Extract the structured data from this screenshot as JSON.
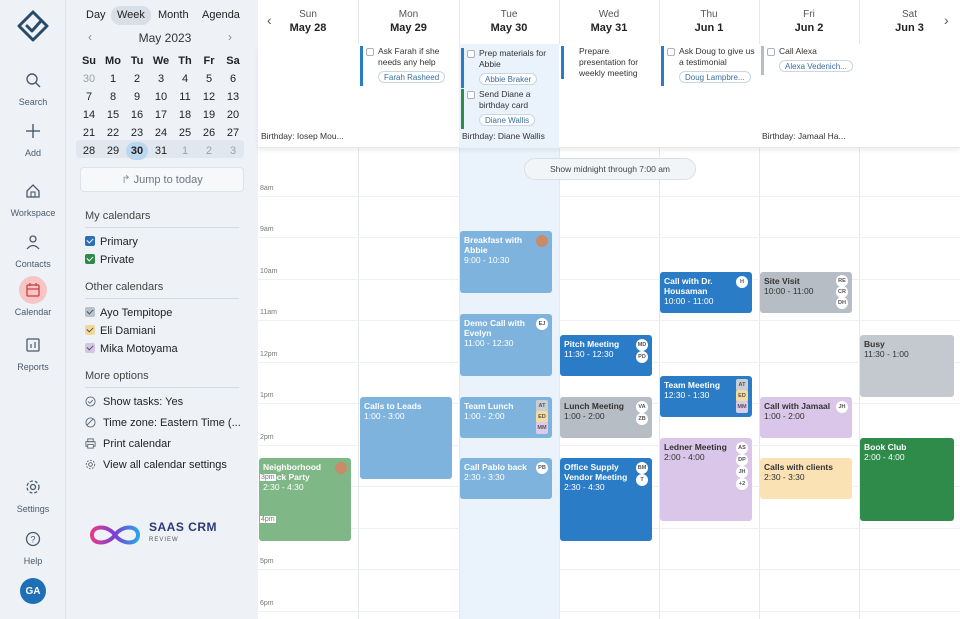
{
  "rail": {
    "items": [
      {
        "label": "Search",
        "icon": "search-icon"
      },
      {
        "label": "Add",
        "icon": "plus-icon"
      },
      {
        "label": "Workspace",
        "icon": "home-icon"
      },
      {
        "label": "Contacts",
        "icon": "person-icon"
      },
      {
        "label": "Calendar",
        "icon": "calendar-icon",
        "active": true
      },
      {
        "label": "Reports",
        "icon": "reports-icon"
      },
      {
        "label": "Settings",
        "icon": "gear-icon"
      },
      {
        "label": "Help",
        "icon": "help-icon"
      }
    ],
    "avatar": "GA"
  },
  "sidebar": {
    "view_tabs": [
      "Day",
      "Week",
      "Month",
      "Agenda"
    ],
    "selected_view": "Week",
    "mini_month": "May 2023",
    "weekdays": [
      "Su",
      "Mo",
      "Tu",
      "We",
      "Th",
      "Fr",
      "Sa"
    ],
    "weeks": [
      [
        "30",
        "1",
        "2",
        "3",
        "4",
        "5",
        "6"
      ],
      [
        "7",
        "8",
        "9",
        "10",
        "11",
        "12",
        "13"
      ],
      [
        "14",
        "15",
        "16",
        "17",
        "18",
        "19",
        "20"
      ],
      [
        "21",
        "22",
        "23",
        "24",
        "25",
        "26",
        "27"
      ],
      [
        "28",
        "29",
        "30",
        "31",
        "1",
        "2",
        "3"
      ]
    ],
    "jump_label": "Jump to today",
    "my_calendars_title": "My calendars",
    "my_calendars": [
      {
        "name": "Primary",
        "color": "#2a6fb8"
      },
      {
        "name": "Private",
        "color": "#2e8b4a"
      }
    ],
    "other_calendars_title": "Other calendars",
    "other_calendars": [
      {
        "name": "Ayo Tempitope",
        "color": "#b9c1ca"
      },
      {
        "name": "Eli Damiani",
        "color": "#f2d79a"
      },
      {
        "name": "Mika Motoyama",
        "color": "#d4c4e6"
      }
    ],
    "more_options_title": "More options",
    "more_options": [
      {
        "label": "Show tasks: Yes",
        "icon": "check-circle-icon"
      },
      {
        "label": "Time zone: Eastern Time (...",
        "icon": "globe-icon"
      },
      {
        "label": "Print calendar",
        "icon": "print-icon"
      },
      {
        "label": "View all calendar settings",
        "icon": "gear-icon"
      }
    ],
    "brand_name": "SAAS CRM",
    "brand_sub": "REVIEW"
  },
  "days": [
    {
      "name": "Sun",
      "date": "May 28"
    },
    {
      "name": "Mon",
      "date": "May 29"
    },
    {
      "name": "Tue",
      "date": "May 30"
    },
    {
      "name": "Wed",
      "date": "May 31"
    },
    {
      "name": "Thu",
      "date": "Jun 1"
    },
    {
      "name": "Fri",
      "date": "Jun 2"
    },
    {
      "name": "Sat",
      "date": "Jun 3"
    }
  ],
  "tasks": {
    "mon": {
      "text": "Ask Farah if she needs any help",
      "pill": "Farah Rasheed"
    },
    "tue1": {
      "text": "Prep materials for Abbie",
      "pill": "Abbie Braker"
    },
    "tue2": {
      "text": "Send Diane a birthday card",
      "pill": "Diane Wallis"
    },
    "wed": {
      "text": "Prepare presentation for weekly meeting"
    },
    "thu": {
      "text": "Ask Doug to give us a testimonial",
      "pill": "Doug Lampbre..."
    },
    "fri": {
      "text": "Call Alexa",
      "pill": "Alexa Vedenich..."
    }
  },
  "birthdays": {
    "sun": "Birthday: Iosep Mou...",
    "tue": "Birthday: Diane Wallis",
    "fri": "Birthday: Jamaal Ha..."
  },
  "show_midnight": "Show midnight through 7:00 am",
  "hours": [
    "8am",
    "9am",
    "10am",
    "11am",
    "12pm",
    "1pm",
    "2pm",
    "3pm",
    "4pm",
    "5pm",
    "6pm"
  ],
  "events": {
    "breakfast": {
      "title": "Breakfast with Abbie",
      "time": "9:00 - 10:30"
    },
    "demo": {
      "title": "Demo Call with Evelyn",
      "time": "11:00 - 12:30",
      "badges": [
        "EJ"
      ]
    },
    "team_lunch": {
      "title": "Team Lunch",
      "time": "1:00 - 2:00",
      "badges": [
        "AT",
        "ED",
        "MM"
      ]
    },
    "call_pablo": {
      "title": "Call Pablo back",
      "time": "2:30 - 3:30",
      "badges": [
        "PB"
      ]
    },
    "calls_leads": {
      "title": "Calls to Leads",
      "time": "1:00 - 3:00"
    },
    "neighborhood": {
      "title": "Neighborhood Block Party",
      "time": "2:30 - 4:30",
      "inner_labels": [
        "3pm",
        "4pm"
      ]
    },
    "pitch": {
      "title": "Pitch Meeting",
      "time": "11:30 - 12:30",
      "badges": [
        "MD",
        "PD"
      ]
    },
    "lunch_meeting": {
      "title": "Lunch Meeting",
      "time": "1:00 - 2:00",
      "badges": [
        "VA",
        "ZB"
      ]
    },
    "office_supply": {
      "title": "Office Supply Vendor Meeting",
      "time": "2:30 - 4:30",
      "badges": [
        "BM",
        "T"
      ]
    },
    "call_dr": {
      "title": "Call with Dr. Housaman",
      "time": "10:00 - 11:00",
      "badges": [
        "H"
      ]
    },
    "team_meeting": {
      "title": "Team Meeting",
      "time": "12:30 - 1:30",
      "badges": [
        "AT",
        "ED",
        "MM"
      ]
    },
    "ledner": {
      "title": "Ledner Meeting",
      "time": "2:00 - 4:00",
      "badges": [
        "AS",
        "DP",
        "JH",
        "+2"
      ]
    },
    "site_visit": {
      "title": "Site Visit",
      "time": "10:00 - 11:00",
      "badges": [
        "RE",
        "CR",
        "DH"
      ]
    },
    "call_jamaal": {
      "title": "Call with Jamaal",
      "time": "1:00 - 2:00",
      "badges": [
        "JH"
      ]
    },
    "calls_clients": {
      "title": "Calls with clients",
      "time": "2:30 - 3:30"
    },
    "busy": {
      "title": "Busy",
      "time": "11:30 - 1:00"
    },
    "book_club": {
      "title": "Book Club",
      "time": "2:00 - 4:00"
    }
  },
  "colors": {
    "primary_blue": "#2a7cc7",
    "light_blue": "#7eb3de",
    "green_light": "#7fb886",
    "green_dark": "#2e8b4a",
    "gray": "#b7bdc4",
    "purple": "#d9c6e8",
    "yellow": "#fbe2b5"
  }
}
